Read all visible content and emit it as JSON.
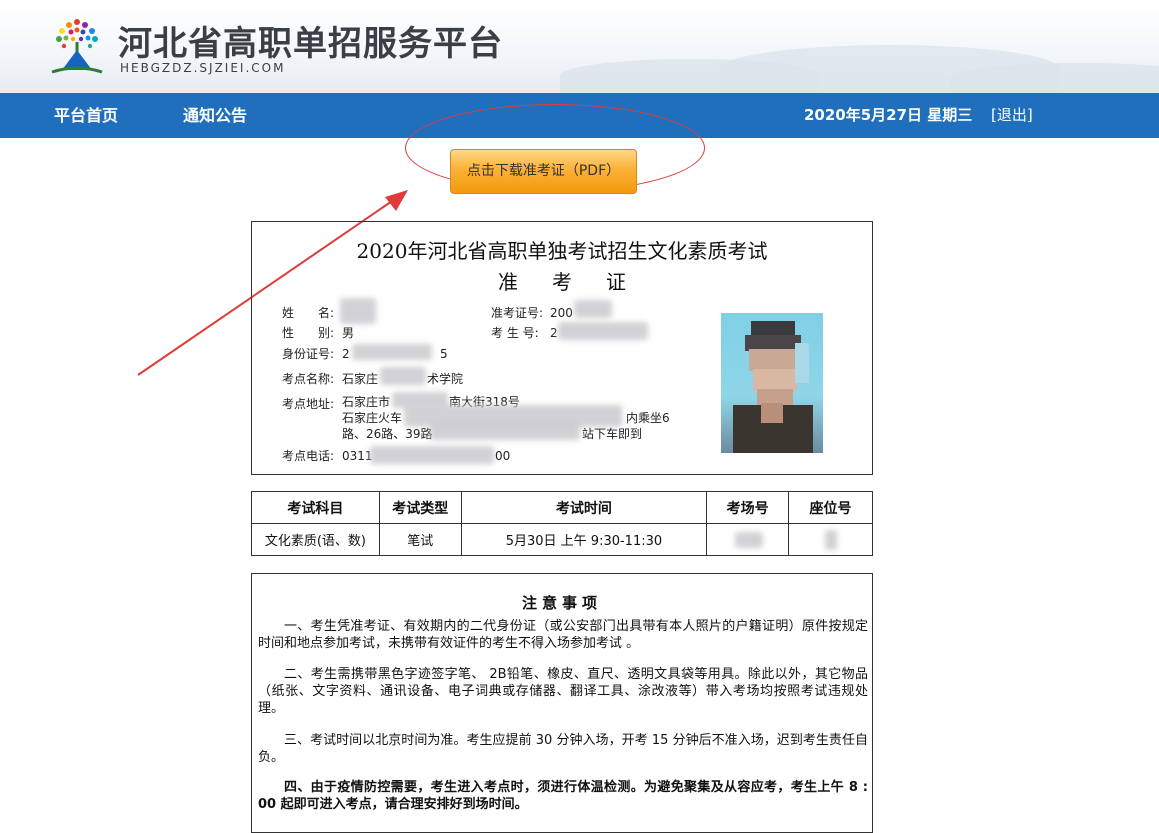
{
  "header": {
    "title": "河北省高职单招服务平台",
    "url": "HEBGZDZ.SJZIEI.COM"
  },
  "nav": {
    "home": "平台首页",
    "notices": "通知公告",
    "date": "2020年5月27日 星期三",
    "logout": "[退出]"
  },
  "download": {
    "label": "点击下载准考证（PDF）"
  },
  "card": {
    "title": "2020年河北省高职单独考试招生文化素质考试",
    "subtitle": "准考证",
    "name_label": "姓　　名:",
    "gender_label": "性　　别:",
    "gender": "男",
    "id_label": "身份证号:",
    "id_value": "2",
    "id_tail": "5",
    "site_label": "考点名称:",
    "site_name_a": "石家庄",
    "site_name_b": "术学院",
    "addr_label": "考点地址:",
    "addr_line1_a": "石家庄市",
    "addr_line1_b": "南大街318号",
    "addr_line2_a": "石家庄火车",
    "addr_line2_b": "内乘坐6",
    "addr_line3_a": "路、26路、39路",
    "addr_line3_b": "站下车即到",
    "phone_label": "考点电话:",
    "phone_a": "0311",
    "phone_b": "00",
    "ticket_label": "准考证号:",
    "ticket_value": "200",
    "exam_no_label": "考 生 号:",
    "exam_no_value": "2"
  },
  "schedule": {
    "headers": [
      "考试科目",
      "考试类型",
      "考试时间",
      "考场号",
      "座位号"
    ],
    "rows": [
      [
        "文化素质(语、数)",
        "笔试",
        "5月30日 上午 9:30-11:30",
        "",
        ""
      ]
    ]
  },
  "notes": {
    "title": "注意事项",
    "items": [
      "一、考生凭准考证、有效期内的二代身份证（或公安部门出具带有本人照片的户籍证明）原件按规定时间和地点参加考试，未携带有效证件的考生不得入场参加考试 。",
      "二、考生需携带黑色字迹签字笔、 2B铅笔、橡皮、直尺、透明文具袋等用具。除此以外，其它物品（纸张、文字资料、通讯设备、电子词典或存储器、翻译工具、涂改液等）带入考场均按照考试违规处理。",
      "三、考试时间以北京时间为准。考生应提前 30 分钟入场，开考 15 分钟后不准入场，迟到考生责任自负。",
      "四、由于疫情防控需要，考生进入考点时，须进行体温检测。为避免聚集及从容应考，考生上午 8 : 00 起即可进入考点，请合理安排好到场时间。"
    ]
  },
  "colors": {
    "nav_bg": "#1f6fbd",
    "button": "#fbb136",
    "annotation_red": "#e03a3a"
  }
}
